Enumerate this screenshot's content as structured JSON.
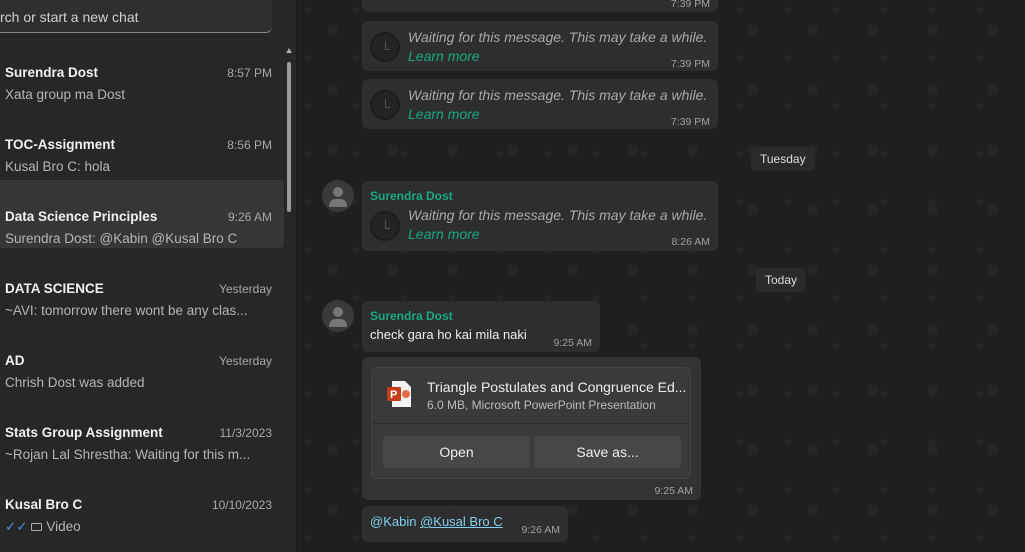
{
  "search": {
    "placeholder": "rch or start a new chat"
  },
  "chats": [
    {
      "name": "Surendra Dost",
      "time": "8:57 PM",
      "preview": "Xata group ma Dost"
    },
    {
      "name": "TOC-Assignment",
      "time": "8:56 PM",
      "preview": "Kusal Bro C: hola"
    },
    {
      "name": "Data Science Principles",
      "time": "9:26 AM",
      "preview": "Surendra Dost: @Kabin @Kusal Bro C"
    },
    {
      "name": "DATA SCIENCE",
      "time": "Yesterday",
      "preview": "~AVI: tomorrow there wont be any clas..."
    },
    {
      "name": "AD",
      "time": "Yesterday",
      "preview": "Chrish Dost was added"
    },
    {
      "name": "Stats Group Assignment",
      "time": "11/3/2023",
      "preview": "~Rojan Lal Shrestha: Waiting for this m..."
    },
    {
      "name": "Kusal Bro C",
      "time": "10/10/2023",
      "preview": "Video"
    }
  ],
  "messages": {
    "waiting_text": "Waiting for this message. This may take a while.",
    "learn_more": "Learn more",
    "t1": "7:39 PM",
    "t2": "7:39 PM",
    "t3": "7:39 PM",
    "day1": "Tuesday",
    "sender": "Surendra Dost",
    "t4": "8:26 AM",
    "day2": "Today",
    "text1": "check gara ho kai mila naki",
    "t5": "9:25 AM",
    "file": {
      "name": "Triangle Postulates and Congruence Ed...",
      "meta": "6.0 MB, Microsoft PowerPoint Presentation",
      "open": "Open",
      "save": "Save as..."
    },
    "t6": "9:25 AM",
    "mention1": "@Kabin",
    "mention2": "@Kusal Bro C",
    "t7": "9:26 AM"
  },
  "colors": {
    "accent": "#19a883",
    "link": "#7fd0ee"
  }
}
